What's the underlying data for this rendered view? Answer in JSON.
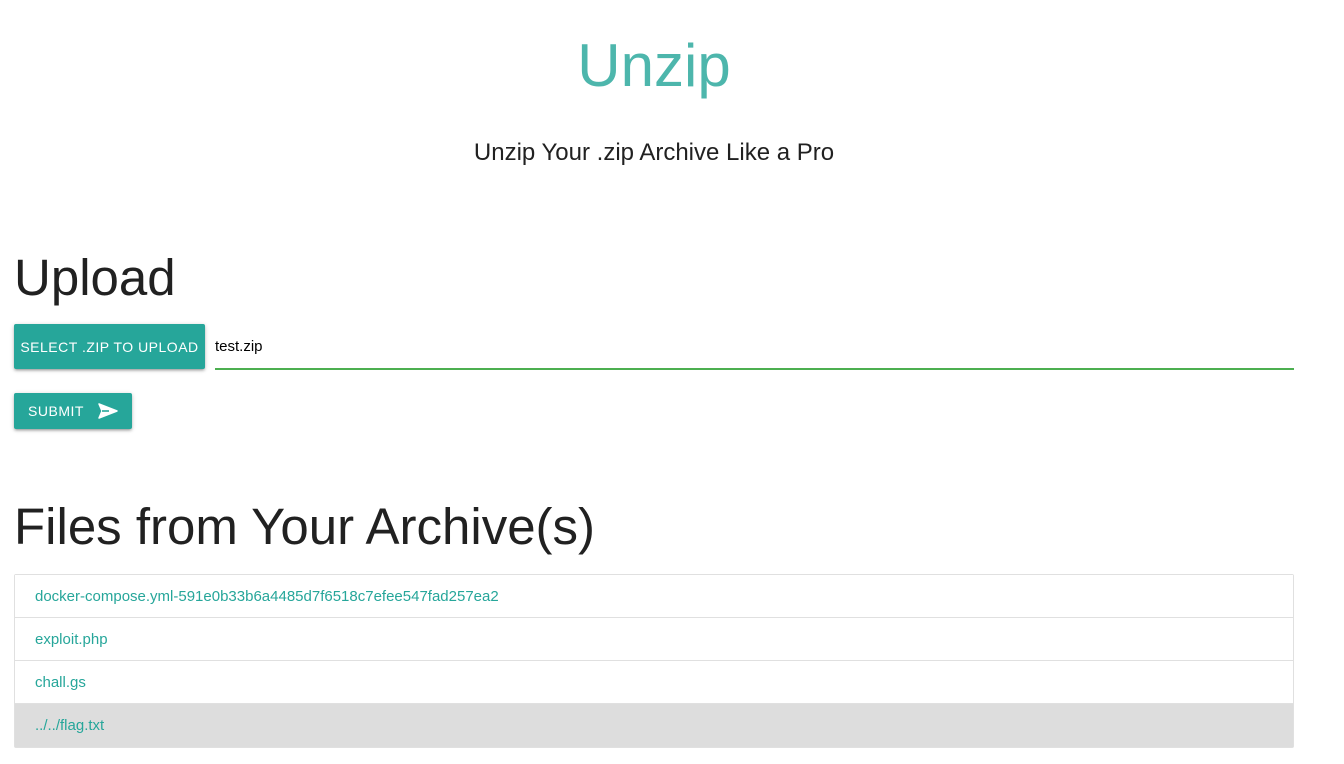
{
  "header": {
    "title": "Unzip",
    "subtitle": "Unzip Your .zip Archive Like a Pro"
  },
  "upload": {
    "heading": "Upload",
    "select_button_label": "SELECT .ZIP TO UPLOAD",
    "file_path_value": "test.zip",
    "submit_button_label": "SUBMIT",
    "submit_icon": "send-icon"
  },
  "files": {
    "heading": "Files from Your Archive(s)",
    "items": [
      {
        "label": "docker-compose.yml-591e0b33b6a4485d7f6518c7efee547fad257ea2",
        "active": false
      },
      {
        "label": "exploit.php",
        "active": false
      },
      {
        "label": "chall.gs",
        "active": false
      },
      {
        "label": "../../flag.txt",
        "active": true
      }
    ]
  },
  "colors": {
    "accent": "#26a69a",
    "title": "#4db6ac",
    "input_underline": "#4caf50",
    "active_row": "#dddddd"
  }
}
